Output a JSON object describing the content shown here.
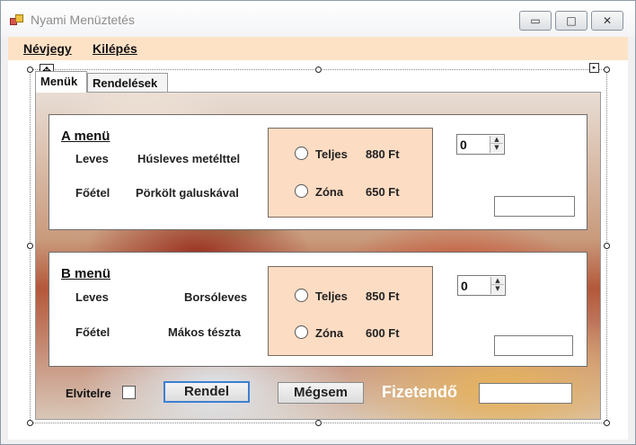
{
  "window": {
    "title": "Nyami Menüztetés",
    "minimize_glyph": "▭",
    "maximize_glyph": "□",
    "close_glyph": "✕"
  },
  "menubar": {
    "items": [
      "Névjegy",
      "Kilépés"
    ]
  },
  "tabs": [
    {
      "label": "Menük",
      "active": true
    },
    {
      "label": "Rendelések",
      "active": false
    }
  ],
  "menus": [
    {
      "title": "A menü",
      "soup_label": "Leves",
      "soup_value": "Húsleves metélttel",
      "main_label": "Főétel",
      "main_value": "Pörkölt galuskával",
      "options": [
        {
          "label": "Teljes",
          "price": "880 Ft"
        },
        {
          "label": "Zóna",
          "price": "650 Ft"
        }
      ],
      "quantity": "0",
      "subtotal": ""
    },
    {
      "title": "B menü",
      "soup_label": "Leves",
      "soup_value": "Borsóleves",
      "main_label": "Főétel",
      "main_value": "Mákos tészta",
      "options": [
        {
          "label": "Teljes",
          "price": "850 Ft"
        },
        {
          "label": "Zóna",
          "price": "600 Ft"
        }
      ],
      "quantity": "0",
      "subtotal": ""
    }
  ],
  "footer": {
    "takeaway_label": "Elvitelre",
    "order_button": "Rendel",
    "cancel_button": "Mégsem",
    "total_label": "Fizetendő",
    "total_value": ""
  },
  "icons": {
    "move_handle": "✥",
    "smart_tag": "▸",
    "spin_up": "▲",
    "spin_down": "▼"
  },
  "colors": {
    "menubar_bg": "#fde2c6",
    "choice_panel_bg": "#fcdcc3",
    "primary_button_border": "#3c7fd1"
  }
}
